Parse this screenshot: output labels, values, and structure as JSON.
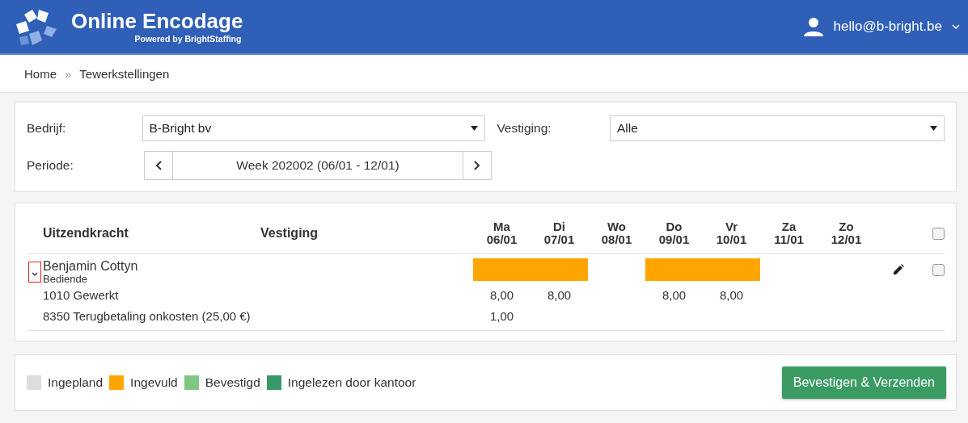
{
  "header": {
    "title": "Online Encodage",
    "subtitle": "Powered by BrightStaffing",
    "user": "hello@b-bright.be"
  },
  "breadcrumb": [
    "Home",
    "Tewerkstellingen"
  ],
  "breadcrumb_separator": "»",
  "filters": {
    "company_label": "Bedrijf:",
    "company": "B-Bright bv",
    "branch_label": "Vestiging:",
    "branch": "Alle",
    "period_label": "Periode:",
    "period": "Week 202002 (06/01 - 12/01)"
  },
  "table": {
    "columns": [
      "Uitzendkracht",
      "Vestiging"
    ],
    "days": [
      {
        "day": "Ma",
        "date": "06/01"
      },
      {
        "day": "Di",
        "date": "07/01"
      },
      {
        "day": "Wo",
        "date": "08/01"
      },
      {
        "day": "Do",
        "date": "09/01"
      },
      {
        "day": "Vr",
        "date": "10/01"
      },
      {
        "day": "Za",
        "date": "11/01"
      },
      {
        "day": "Zo",
        "date": "12/01"
      }
    ],
    "all_checked": false,
    "rows": [
      {
        "name": "Benjamin Cottyn",
        "role": "Bediende",
        "expanded": true,
        "checked": false,
        "days": [
          {
            "kind": "bar",
            "color": "#ffa500"
          },
          {
            "kind": "bar",
            "color": "#ffa500"
          },
          {
            "kind": "empty"
          },
          {
            "kind": "bar",
            "color": "#ffa500"
          },
          {
            "kind": "bar",
            "color": "#ffa500"
          },
          {
            "kind": "empty"
          },
          {
            "kind": "empty"
          }
        ],
        "lines": [
          {
            "label": "1010 Gewerkt",
            "values": [
              {
                "kind": "hours",
                "hours": "8,00"
              },
              {
                "kind": "hours",
                "hours": "8,00"
              },
              {
                "kind": "empty"
              },
              {
                "kind": "hours",
                "hours": "8,00"
              },
              {
                "kind": "hours",
                "hours": "8,00"
              },
              {
                "kind": "empty"
              },
              {
                "kind": "empty"
              }
            ]
          },
          {
            "label": "8350 Terugbetaling onkosten (25,00 €)",
            "values": [
              {
                "kind": "hours",
                "hours": "1,00"
              },
              {
                "kind": "empty"
              },
              {
                "kind": "empty"
              },
              {
                "kind": "empty"
              },
              {
                "kind": "empty"
              },
              {
                "kind": "empty"
              },
              {
                "kind": "empty"
              }
            ]
          }
        ]
      }
    ]
  },
  "legend": [
    {
      "label": "Ingepland",
      "color": "#dddddd"
    },
    {
      "label": "Ingevuld",
      "color": "#ffa500"
    },
    {
      "label": "Bevestigd",
      "color": "#81c784"
    },
    {
      "label": "Ingelezen door kantoor",
      "color": "#38996b"
    }
  ],
  "submit": "Bevestigen & Verzenden"
}
